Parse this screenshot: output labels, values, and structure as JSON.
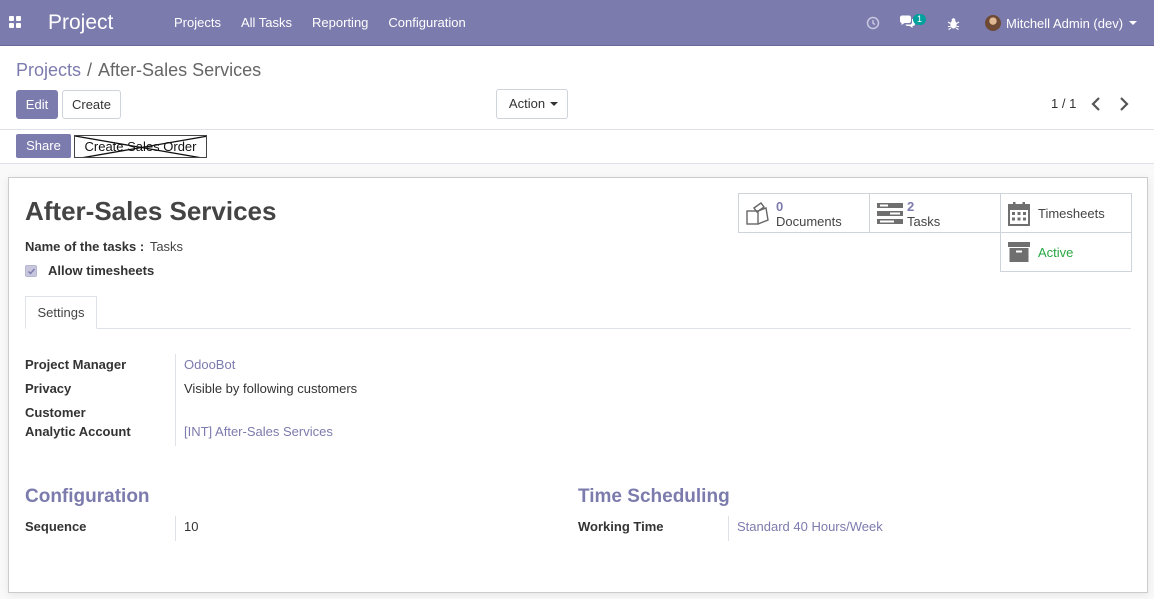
{
  "navbar": {
    "brand": "Project",
    "menu": [
      "Projects",
      "All Tasks",
      "Reporting",
      "Configuration"
    ],
    "chat_count": "1",
    "user_name": "Mitchell Admin (dev)",
    "color": "#7c7bad"
  },
  "breadcrumb": {
    "parent": "Projects",
    "separator": "/",
    "current": "After-Sales Services"
  },
  "toolbar": {
    "edit_label": "Edit",
    "create_label": "Create",
    "action_label": "Action",
    "pager": "1 / 1"
  },
  "statusbar": {
    "share_label": "Share",
    "sales_order_label": "Create Sales Order"
  },
  "form": {
    "title": "After-Sales Services",
    "tasks_name_label": "Name of the tasks :",
    "tasks_name_value": "Tasks",
    "allow_timesheets_label": "Allow timesheets",
    "allow_timesheets_checked": true
  },
  "smart_buttons": {
    "documents": {
      "count": "0",
      "label": "Documents",
      "icon": "files-icon"
    },
    "tasks": {
      "count": "2",
      "label": "Tasks",
      "icon": "tasks-icon"
    },
    "timesheets": {
      "label": "Timesheets",
      "icon": "calendar-icon"
    },
    "active": {
      "label": "Active",
      "icon": "archive-icon",
      "color": "#28a745"
    }
  },
  "tabs": {
    "settings": "Settings"
  },
  "settings": {
    "project_manager_label": "Project Manager",
    "project_manager_value": "OdooBot",
    "privacy_label": "Privacy",
    "privacy_value": "Visible by following customers",
    "customer_label": "Customer",
    "customer_value": "",
    "analytic_label": "Analytic Account",
    "analytic_value": "[INT] After-Sales Services"
  },
  "configuration": {
    "title": "Configuration",
    "sequence_label": "Sequence",
    "sequence_value": "10"
  },
  "time_scheduling": {
    "title": "Time Scheduling",
    "working_time_label": "Working Time",
    "working_time_value": "Standard 40 Hours/Week"
  }
}
